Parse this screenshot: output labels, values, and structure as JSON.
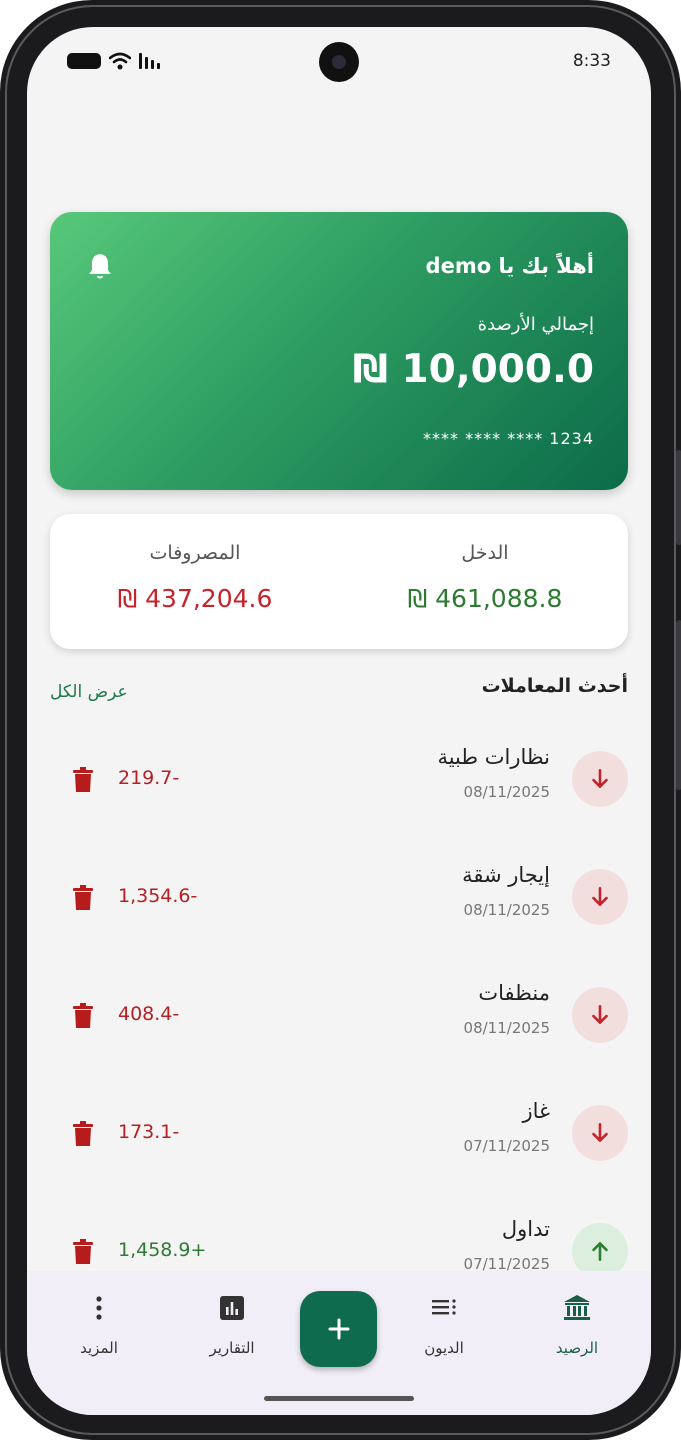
{
  "status_bar": {
    "time": "8:33"
  },
  "balance_card": {
    "greeting": "أهلاً بك يا demo",
    "total_label": "إجمالي الأرصدة",
    "total_amount": "₪ 10,000.0",
    "card_number": "**** **** **** 1234",
    "icon": "bell-icon"
  },
  "summary": {
    "income_label": "الدخل",
    "income_value": "₪ 461,088.8",
    "expense_label": "المصروفات",
    "expense_value": "₪ 437,204.6"
  },
  "recent": {
    "title": "أحدث المعاملات",
    "view_all": "عرض الكل",
    "transactions": [
      {
        "name": "نظارات طبية",
        "date": "08/11/2025",
        "amount": "219.7-",
        "type": "expense"
      },
      {
        "name": "إيجار شقة",
        "date": "08/11/2025",
        "amount": "1,354.6-",
        "type": "expense"
      },
      {
        "name": "منظفات",
        "date": "08/11/2025",
        "amount": "408.4-",
        "type": "expense"
      },
      {
        "name": "غاز",
        "date": "07/11/2025",
        "amount": "173.1-",
        "type": "expense"
      },
      {
        "name": "تداول",
        "date": "07/11/2025",
        "amount": "1,458.9+",
        "type": "income"
      }
    ]
  },
  "bottom_nav": {
    "items": [
      {
        "label": "الرصيد",
        "icon": "bank-icon"
      },
      {
        "label": "الديون",
        "icon": "list-icon"
      },
      {
        "label": "التقارير",
        "icon": "chart-icon"
      },
      {
        "label": "المزيد",
        "icon": "more-vertical-icon"
      }
    ],
    "add_icon": "plus-icon"
  },
  "colors": {
    "primary": "#0e6b4e",
    "card_light": "#57c87a",
    "income": "#2f7a33",
    "expense": "#c6222c"
  }
}
